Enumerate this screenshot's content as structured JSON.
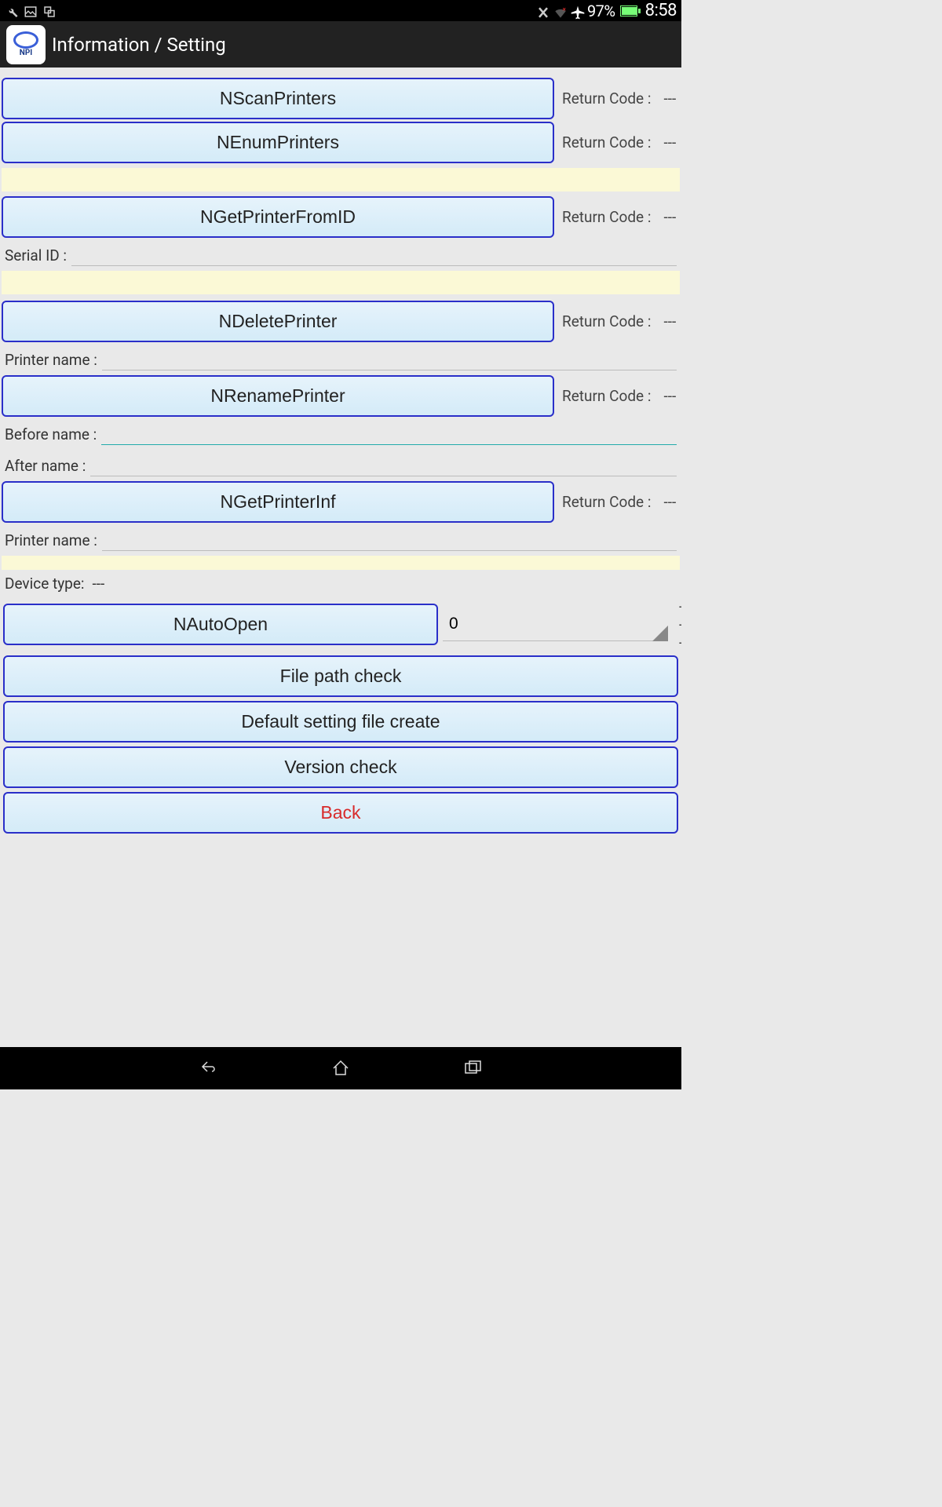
{
  "status": {
    "battery_pct": "97%",
    "time": "8:58"
  },
  "header": {
    "title": "Information / Setting",
    "app_icon_label": "NPI"
  },
  "labels": {
    "return_code": "Return Code :",
    "serial_id": "Serial ID :",
    "printer_name": "Printer name :",
    "before_name": "Before name :",
    "after_name": "After name :",
    "device_type": "Device type:"
  },
  "values": {
    "return_dash": "---",
    "device_type_value": "---",
    "auto_open_count": "0",
    "auto_open_dash": "---"
  },
  "buttons": {
    "scan": "NScanPrinters",
    "enum": "NEnumPrinters",
    "get_from_id": "NGetPrinterFromID",
    "delete": "NDeletePrinter",
    "rename": "NRenamePrinter",
    "get_inf": "NGetPrinterInf",
    "auto_open": "NAutoOpen",
    "file_path": "File path check",
    "default_setting": "Default setting file create",
    "version": "Version check",
    "back": "Back"
  }
}
